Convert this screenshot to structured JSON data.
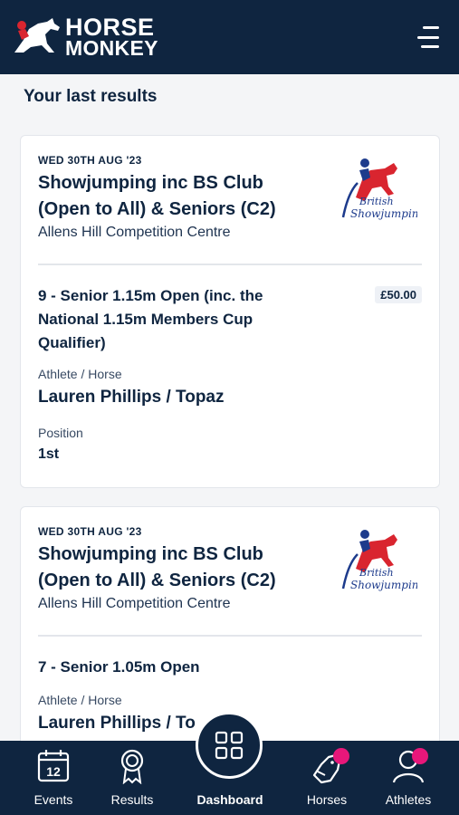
{
  "header": {
    "logo_line1": "HORSE",
    "logo_line2": "MONKEY",
    "menu_icon": "hamburger-menu-icon"
  },
  "section_title": "Your last results",
  "results": [
    {
      "date": "WED 30TH AUG '23",
      "competition": "Showjumping inc BS Club (Open to All) & Seniors (C2)",
      "venue": "Allens Hill Competition Centre",
      "organiser_logo": {
        "text_line1": "British",
        "text_line2": "Showjumping"
      },
      "class_name": "9 - Senior 1.15m Open (inc. the National 1.15m Members Cup Qualifier)",
      "prize": "£50.00",
      "athlete_horse_label": "Athlete / Horse",
      "athlete_horse": "Lauren Phillips / Topaz",
      "position_label": "Position",
      "position": "1st"
    },
    {
      "date": "WED 30TH AUG '23",
      "competition": "Showjumping inc BS Club (Open to All) & Seniors (C2)",
      "venue": "Allens Hill Competition Centre",
      "organiser_logo": {
        "text_line1": "British",
        "text_line2": "Showjumping"
      },
      "class_name": "7 - Senior 1.05m Open",
      "athlete_horse_label": "Athlete / Horse",
      "athlete_horse": "Lauren Phillips / To"
    }
  ],
  "tabbar": {
    "events": {
      "label": "Events",
      "icon": "calendar-icon",
      "calendar_day": "12"
    },
    "results": {
      "label": "Results",
      "icon": "rosette-icon"
    },
    "dashboard": {
      "label": "Dashboard",
      "icon": "grid-icon"
    },
    "horses": {
      "label": "Horses",
      "icon": "horse-head-icon",
      "has_notification": true
    },
    "athletes": {
      "label": "Athletes",
      "icon": "person-icon",
      "has_notification": true
    }
  },
  "colors": {
    "navy": "#0f2540",
    "background": "#f4f5f7",
    "notification": "#e8177a",
    "bs_red": "#d9252f",
    "bs_blue": "#1d3b8c"
  }
}
